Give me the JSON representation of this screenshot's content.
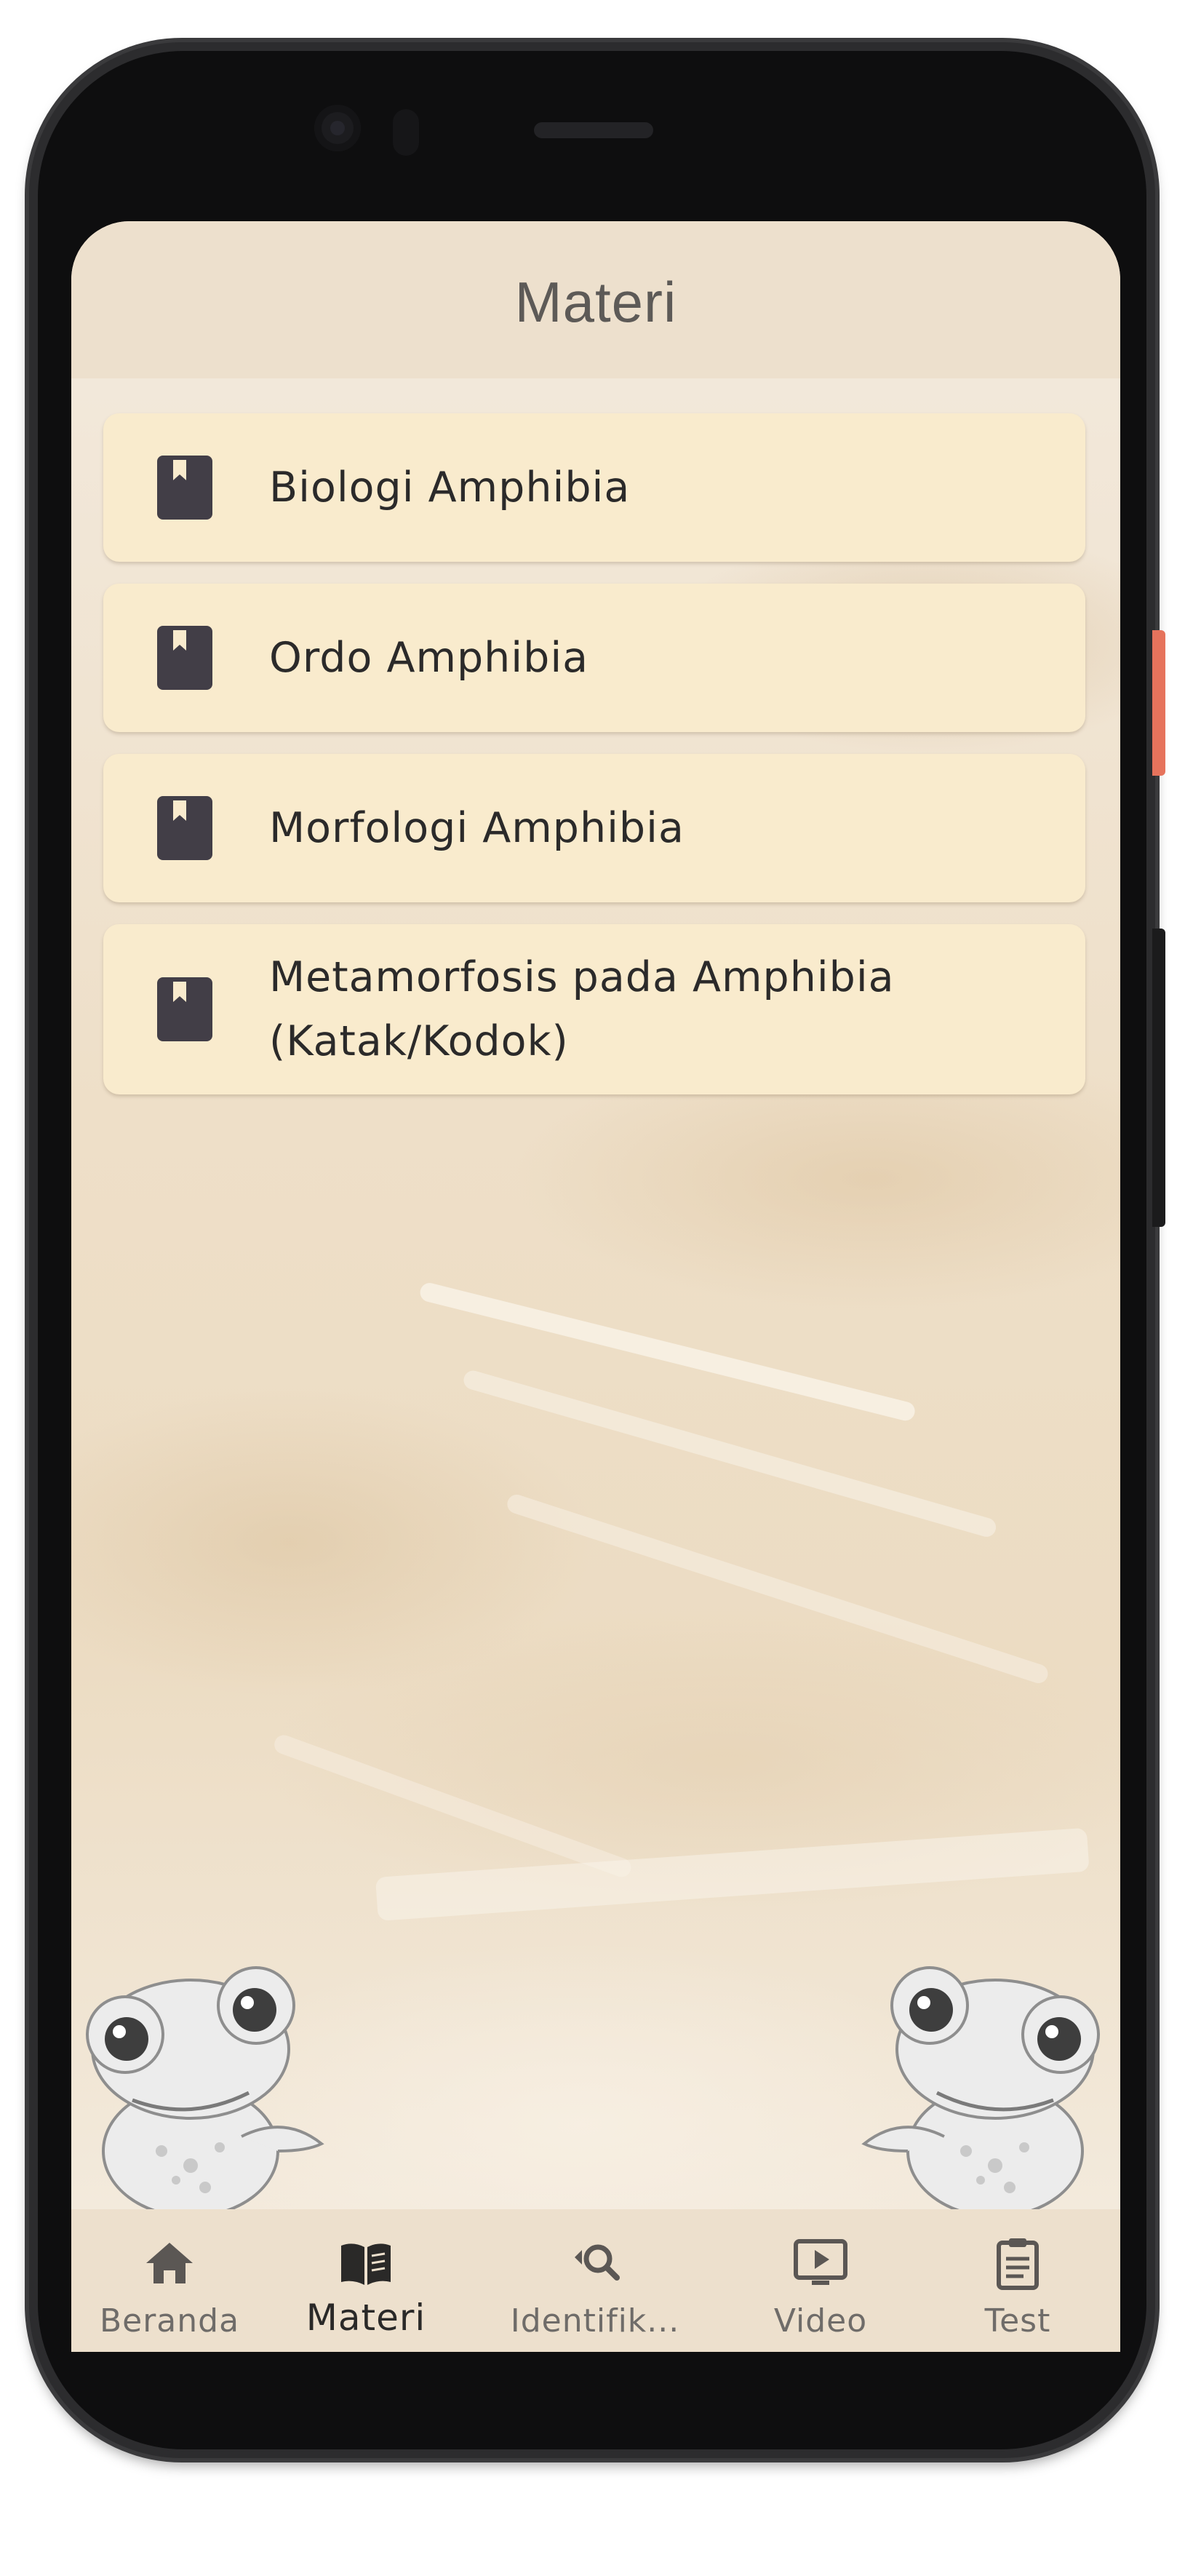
{
  "app_bar": {
    "title": "Materi"
  },
  "materi_list": [
    {
      "label": "Biologi Amphibia",
      "icon": "book-icon"
    },
    {
      "label": "Ordo Amphibia",
      "icon": "book-icon"
    },
    {
      "label": "Morfologi Amphibia",
      "icon": "book-icon"
    },
    {
      "label": "Metamorfosis pada Amphibia (Katak/Kodok)",
      "icon": "book-icon"
    }
  ],
  "bottom_nav": {
    "items": [
      {
        "label": "Beranda",
        "icon": "home-icon",
        "active": false
      },
      {
        "label": "Materi",
        "icon": "open-book-icon",
        "active": true
      },
      {
        "label": "Identifik...",
        "icon": "search-refresh-icon",
        "active": false
      },
      {
        "label": "Video",
        "icon": "video-play-icon",
        "active": false
      },
      {
        "label": "Test",
        "icon": "clipboard-icon",
        "active": false
      }
    ]
  },
  "colors": {
    "app_bar_bg": "#ede0cd",
    "card_bg": "#f9ebcd",
    "icon_dark": "#423e47",
    "text_dark": "#2b2a2a",
    "accent_side_button": "#e6735c"
  }
}
